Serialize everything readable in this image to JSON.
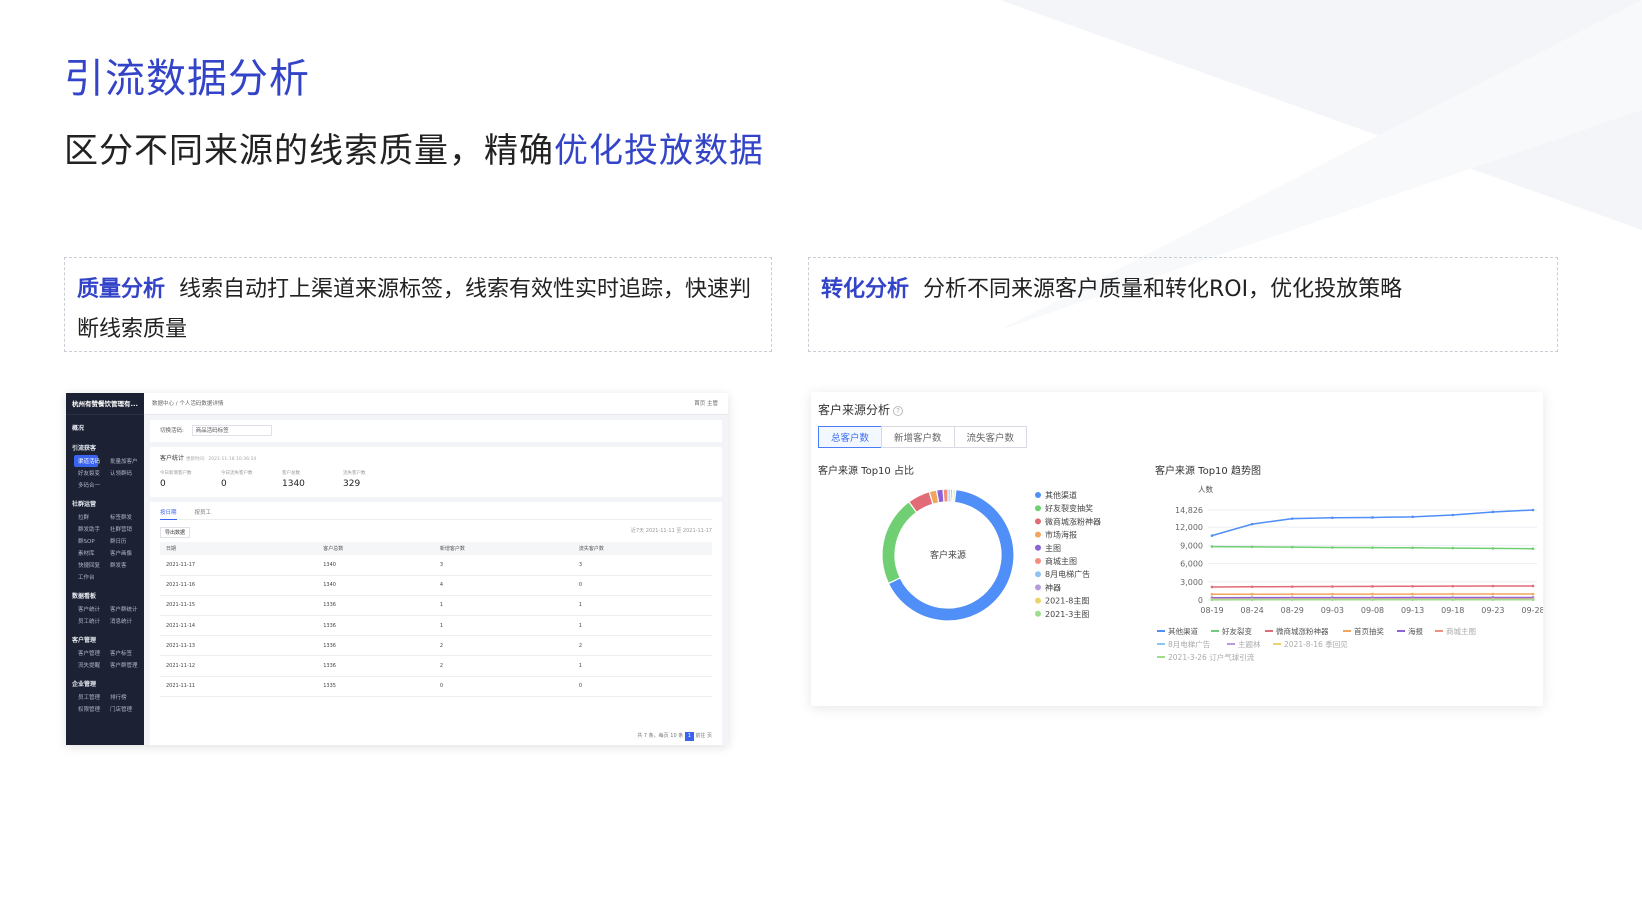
{
  "title": "引流数据分析",
  "subtitle": {
    "prefix": "区分不同来源的线索质量，精确",
    "highlight": "优化投放数据"
  },
  "features": [
    {
      "tag": "质量分析",
      "text": "线索自动打上渠道来源标签，线索有效性实时追踪，快速判断线索质量"
    },
    {
      "tag": "转化分析",
      "text": "分析不同来源客户质量和转化ROI，优化投放策略"
    }
  ],
  "screenshot_left": {
    "brand": "杭州有赞餐饮管理有...",
    "breadcrumb": "数据中心 / 个人活码数据详情",
    "topbar_right": "首页   主管",
    "nav": [
      {
        "section": "概况",
        "items": []
      },
      {
        "section": "引流获客",
        "items": [
          "渠道活码",
          "批量加客户",
          "好友裂变",
          "认领群码",
          "多码合一"
        ]
      },
      {
        "section": "社群运营",
        "items": [
          "拉群",
          "标签群发",
          "群发助手",
          "社群营销",
          "群SOP",
          "群日历",
          "素材库",
          "客户画像",
          "快捷回复",
          "群发客",
          "工作台"
        ]
      },
      {
        "section": "数据看板",
        "items": [
          "客户统计",
          "客户群统计",
          "员工统计",
          "消息统计"
        ]
      },
      {
        "section": "客户管理",
        "items": [
          "客户管理",
          "客户标签",
          "流失提醒",
          "客户群管理"
        ]
      },
      {
        "section": "企业管理",
        "items": [
          "员工管理",
          "排行榜",
          "权限管理",
          "门店管理"
        ]
      }
    ],
    "filter_label": "切换活码:",
    "filter_value": "商品活码标签",
    "stats_title": "客户统计",
    "stats_time": "更新时间：2021-11-18 10:36:34",
    "stats": [
      {
        "label": "今日新增客户数",
        "value": "0"
      },
      {
        "label": "今日流失客户数",
        "value": "0"
      },
      {
        "label": "客户总数",
        "value": "1340"
      },
      {
        "label": "流失客户数",
        "value": "329"
      }
    ],
    "tabs": [
      "按日期",
      "按员工"
    ],
    "export": "导出数据",
    "range": "近7天   2021-11-11 至 2021-11-17",
    "columns": [
      "日期",
      "客户总数",
      "新增客户数",
      "流失客户数"
    ],
    "rows": [
      [
        "2021-11-17",
        "1340",
        "3",
        "3"
      ],
      [
        "2021-11-16",
        "1340",
        "4",
        "0"
      ],
      [
        "2021-11-15",
        "1336",
        "1",
        "1"
      ],
      [
        "2021-11-14",
        "1336",
        "1",
        "1"
      ],
      [
        "2021-11-13",
        "1336",
        "2",
        "2"
      ],
      [
        "2021-11-12",
        "1336",
        "2",
        "1"
      ],
      [
        "2021-11-11",
        "1335",
        "0",
        "0"
      ]
    ],
    "pager": "共 7 条，每页 10 条",
    "page": "1",
    "goto": "前往   页"
  },
  "screenshot_right": {
    "title": "客户来源分析",
    "tabs": [
      "总客户数",
      "新增客户数",
      "流失客户数"
    ],
    "pie_title": "客户来源 Top10 占比",
    "trend_title": "客户来源 Top10 趋势图"
  },
  "chart_data": [
    {
      "type": "pie",
      "title": "客户来源 Top10 占比",
      "center_label": "客户来源",
      "labels": [
        "其他渠道",
        "好友裂变抽奖",
        "微商城涨粉神器",
        "市场海报",
        "主图",
        "商城主图",
        "8月电梯广告",
        "神器",
        "2021-8主图",
        "2021-3主图"
      ],
      "values": [
        66,
        22,
        5.5,
        1.8,
        1.6,
        1.2,
        0.6,
        0.5,
        0.4,
        0.4
      ],
      "colors": [
        "#4f8ff7",
        "#6fcf72",
        "#e26b78",
        "#f1a65f",
        "#8a63d8",
        "#f08f7a",
        "#8ec4f2",
        "#b69cd8",
        "#e9d56b",
        "#9fdc8d"
      ],
      "legend_position": "right"
    },
    {
      "type": "line",
      "title": "客户来源 Top10 趋势图",
      "ylabel": "人数",
      "ylim": [
        0,
        14826
      ],
      "yticks": [
        "0",
        "3,000",
        "6,000",
        "9,000",
        "12,000",
        "14,826"
      ],
      "x": [
        "08-19",
        "08-24",
        "08-29",
        "09-03",
        "09-08",
        "09-13",
        "09-18",
        "09-23",
        "09-28"
      ],
      "grid": true,
      "legend_position": "bottom",
      "series": [
        {
          "name": "其他渠道",
          "color": "#4f8ff7",
          "values": [
            10600,
            12500,
            13400,
            13550,
            13600,
            13700,
            14000,
            14500,
            14826
          ]
        },
        {
          "name": "好友裂变",
          "color": "#6fcf72",
          "values": [
            8800,
            8750,
            8700,
            8650,
            8620,
            8600,
            8550,
            8500,
            8450
          ]
        },
        {
          "name": "微商城涨粉神器",
          "color": "#e26b78",
          "values": [
            2150,
            2180,
            2200,
            2220,
            2250,
            2260,
            2280,
            2300,
            2310
          ]
        },
        {
          "name": "首页抽奖",
          "color": "#f1a65f",
          "values": [
            950,
            955,
            960,
            965,
            970,
            975,
            980,
            985,
            990
          ]
        },
        {
          "name": "海报",
          "color": "#8a63d8",
          "values": [
            380,
            385,
            390,
            395,
            400,
            405,
            410,
            415,
            420
          ]
        },
        {
          "name": "商城主图",
          "color": "#f08f7a",
          "values": [
            200,
            202,
            205,
            207,
            210,
            212,
            215,
            218,
            220
          ]
        },
        {
          "name": "8月电梯广告",
          "color": "#8ec4f2",
          "values": [
            120,
            121,
            122,
            123,
            124,
            125,
            126,
            127,
            128
          ]
        },
        {
          "name": "主题林",
          "color": "#b69cd8",
          "values": [
            80,
            81,
            82,
            83,
            84,
            85,
            86,
            87,
            88
          ]
        },
        {
          "name": "2021-8-16 季回见",
          "color": "#e9d56b",
          "values": [
            50,
            51,
            52,
            53,
            54,
            55,
            56,
            57,
            58
          ]
        },
        {
          "name": "2021-3-26 订户气球引流",
          "color": "#9fdc8d",
          "values": [
            30,
            31,
            32,
            33,
            34,
            35,
            36,
            37,
            38
          ]
        }
      ]
    }
  ]
}
